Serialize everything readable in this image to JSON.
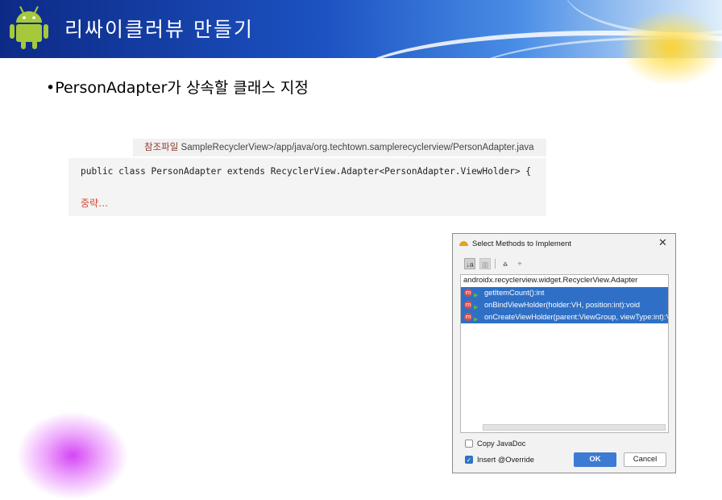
{
  "slide": {
    "title": "리싸이클러뷰 만들기",
    "bullet": "•PersonAdapter가 상속할 클래스 지정"
  },
  "reference": {
    "label": "참조파일",
    "path": "SampleRecyclerView>/app/java/org.techtown.samplerecyclerview/PersonAdapter.java"
  },
  "code": {
    "line1": "public class PersonAdapter extends RecyclerView.Adapter<PersonAdapter.ViewHolder> {",
    "omitted": "중략…"
  },
  "dialog": {
    "title": "Select Methods to Implement",
    "close": "✕",
    "toolbar": {
      "sort": "↓a",
      "tree": "▥",
      "expand": "⩠",
      "collapse": "÷"
    },
    "class_name": "androidx.recyclerview.widget.RecyclerView.Adapter",
    "methods": [
      {
        "icon": "m",
        "label": "getItemCount():int"
      },
      {
        "icon": "m",
        "label": "onBindViewHolder(holder:VH, position:int):void"
      },
      {
        "icon": "m",
        "label": "onCreateViewHolder(parent:ViewGroup, viewType:int):VH"
      }
    ],
    "options": [
      {
        "label": "Copy JavaDoc",
        "checked": false
      },
      {
        "label": "Insert @Override",
        "checked": true
      }
    ],
    "ok": "OK",
    "cancel": "Cancel"
  },
  "colors": {
    "header_dark": "#0d2a86",
    "header_light": "#4a8ee6",
    "selection": "#2f70c6",
    "ok_button": "#3d7ad3",
    "omit_text": "#d24a38"
  }
}
